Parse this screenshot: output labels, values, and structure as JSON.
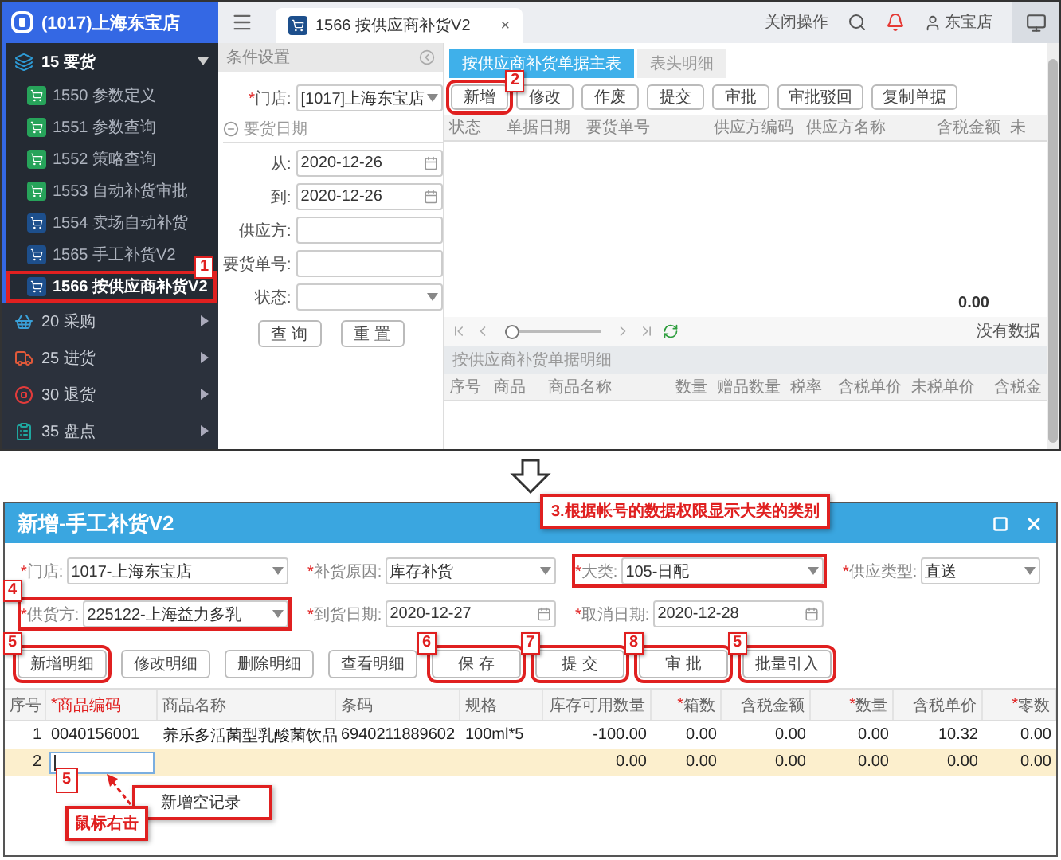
{
  "top_screen": {
    "sidebar": {
      "store": "(1017)上海东宝店",
      "groups": [
        {
          "label": "15 要货",
          "color": "#2e9bd6",
          "expanded": true,
          "children": [
            {
              "label": "1550 参数定义",
              "color": "#27a35a",
              "selected": false
            },
            {
              "label": "1551 参数查询",
              "color": "#27a35a",
              "selected": false
            },
            {
              "label": "1552 策略查询",
              "color": "#27a35a",
              "selected": false
            },
            {
              "label": "1553 自动补货审批",
              "color": "#27a35a",
              "selected": false
            },
            {
              "label": "1554 卖场自动补货",
              "color": "#1d4f8c",
              "selected": false
            },
            {
              "label": "1565 手工补货V2",
              "color": "#1d4f8c",
              "selected": false
            },
            {
              "label": "1566 按供应商补货V2",
              "color": "#1d4f8c",
              "selected": true,
              "annotation": "1"
            }
          ]
        },
        {
          "label": "20 采购",
          "color": "#3aa0d8",
          "expanded": false
        },
        {
          "label": "25 进货",
          "color": "#e0593a",
          "expanded": false
        },
        {
          "label": "30 退货",
          "color": "#e23b3b",
          "expanded": false
        },
        {
          "label": "35 盘点",
          "color": "#1fa7a0",
          "expanded": false
        }
      ]
    },
    "topbar": {
      "tabs": [
        {
          "label": "1566 按供应商补货V2",
          "close": "×",
          "selected": true
        }
      ],
      "close_menu": "关闭操作",
      "user": "东宝店"
    },
    "filter_panel": {
      "title": "条件设置",
      "fields": [
        {
          "kind": "select",
          "mark": "*",
          "label": "门店:",
          "value": "[1017]上海东宝店"
        },
        {
          "kind": "group",
          "label": "要货日期"
        },
        {
          "kind": "date",
          "label": "从:",
          "value": "2020-12-26"
        },
        {
          "kind": "date",
          "label": "到:",
          "value": "2020-12-26"
        },
        {
          "kind": "text",
          "label": "供应方:"
        },
        {
          "kind": "text",
          "label": "要货单号:"
        },
        {
          "kind": "select",
          "label": "状态:"
        }
      ],
      "buttons": [
        "查 询",
        "重 置"
      ]
    },
    "main": {
      "tabs": [
        {
          "label": "按供应商补货单据主表",
          "selected": true
        },
        {
          "label": "表头明细",
          "selected": false
        }
      ],
      "buttons": [
        {
          "label": "新增",
          "annotation": "2"
        },
        {
          "label": "修改"
        },
        {
          "label": "作废"
        },
        {
          "label": "提交"
        },
        {
          "label": "审批"
        },
        {
          "label": "审批驳回"
        },
        {
          "label": "复制单据"
        }
      ],
      "columns": [
        "状态",
        "单据日期",
        "要货单号",
        "供应方编码",
        "供应方名称",
        "含税金额",
        "未"
      ],
      "total": "0.00",
      "pager": {
        "level": 0,
        "status": "没有数据"
      },
      "detail": {
        "title": "按供应商补货单据明细",
        "columns": [
          "序号",
          "商品",
          "商品名称",
          "数量",
          "赠品数量",
          "税率",
          "含税单价",
          "未税单价",
          "含税金"
        ]
      }
    }
  },
  "dialog": {
    "title": "新增-手工补货V2",
    "fields": [
      {
        "kind": "select",
        "mark": "*",
        "label": "门店:",
        "value": "1017-上海东宝店"
      },
      {
        "kind": "select",
        "mark": "*",
        "label": "补货原因:",
        "value": "库存补货"
      },
      {
        "kind": "select",
        "mark": "*",
        "label": "大类:",
        "value": "105-日配",
        "callout": "3.根据帐号的数据权限显示大类的类别"
      },
      {
        "kind": "select",
        "mark": "*",
        "label": "供应类型:",
        "value": "直送"
      },
      {
        "kind": "select",
        "mark": "*",
        "label": "供货方:",
        "value": "225122-上海益力多乳",
        "annotation": "4"
      },
      {
        "kind": "date",
        "mark": "*",
        "label": "到货日期:",
        "value": "2020-12-27"
      },
      {
        "kind": "date",
        "mark": "*",
        "label": "取消日期:",
        "value": "2020-12-28"
      }
    ],
    "buttons": [
      {
        "label": "新增明细",
        "annotation": "5"
      },
      {
        "label": "修改明细"
      },
      {
        "label": "删除明细"
      },
      {
        "label": "查看明细"
      },
      {
        "label": "保 存",
        "annotation": "6"
      },
      {
        "label": "提 交",
        "annotation": "7"
      },
      {
        "label": "审 批",
        "annotation": "8"
      },
      {
        "label": "批量引入",
        "annotation": "5"
      }
    ],
    "columns": [
      {
        "label": "序号",
        "highlighted": false
      },
      {
        "mark": "*",
        "label": "商品编码",
        "highlighted": true
      },
      {
        "label": "商品名称",
        "highlighted": false
      },
      {
        "label": "条码",
        "highlighted": false
      },
      {
        "label": "规格",
        "highlighted": false
      },
      {
        "label": "库存可用数量",
        "highlighted": false
      },
      {
        "mark": "*",
        "label": "箱数",
        "highlighted": false
      },
      {
        "label": "含税金额",
        "highlighted": false
      },
      {
        "mark": "*",
        "label": "数量",
        "highlighted": false
      },
      {
        "label": "含税单价",
        "highlighted": false
      },
      {
        "mark": "*",
        "label": "零数",
        "highlighted": false
      }
    ],
    "rows": [
      {
        "selected": false,
        "editing": false,
        "cells": [
          "1",
          "0040156001",
          "养乐多活菌型乳酸菌饮品",
          "6940211889602",
          "100ml*5",
          "-100.00",
          "0.00",
          "0.00",
          "0.00",
          "10.32",
          "0.00"
        ]
      },
      {
        "selected": true,
        "editing": true,
        "cells": [
          "2",
          null,
          null,
          null,
          null,
          "0.00",
          "0.00",
          "0.00",
          "0.00",
          "0.00",
          "0.00"
        ]
      }
    ],
    "context_menu": {
      "items": [
        "新增空记录"
      ],
      "annotation": "5",
      "note": "鼠标右击"
    }
  }
}
